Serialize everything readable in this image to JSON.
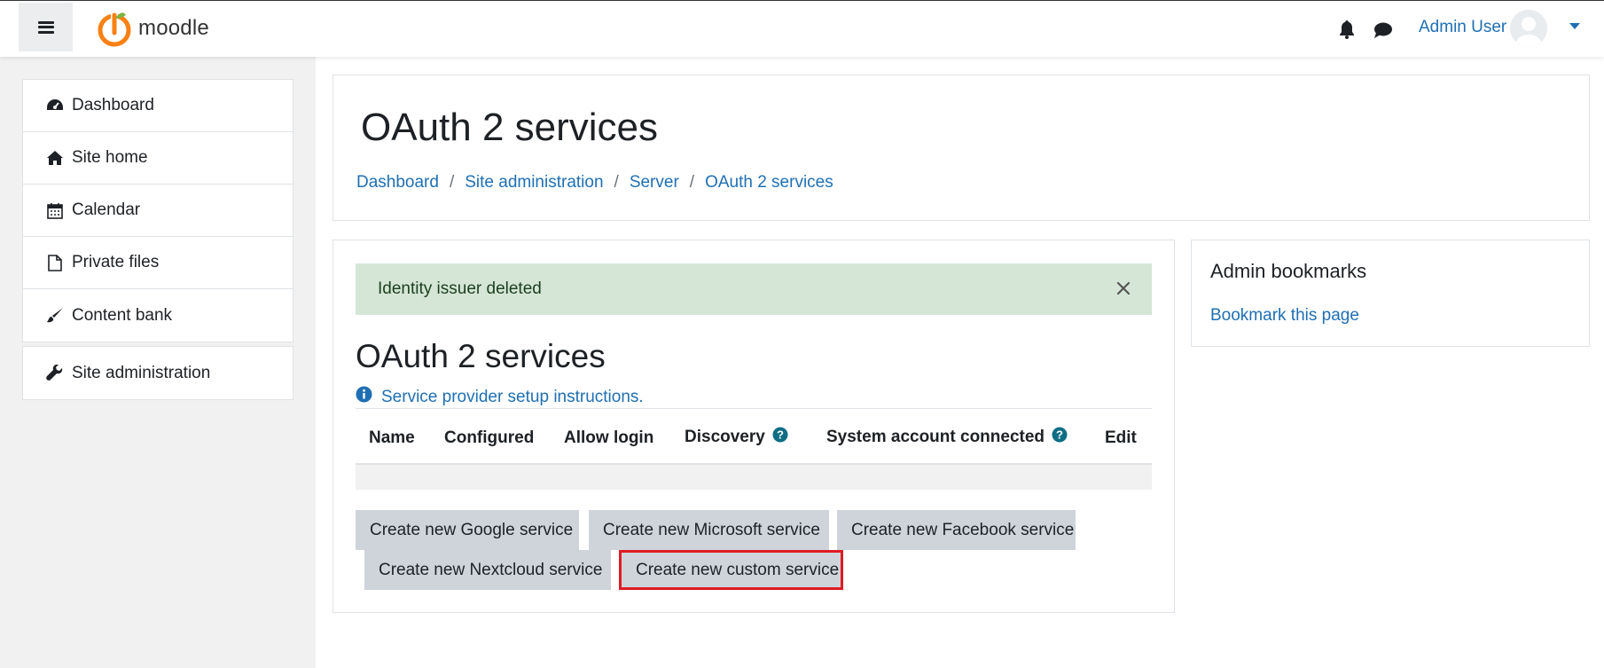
{
  "navbar": {
    "brand": "moodle",
    "user_name": "Admin User",
    "icons": {
      "menu": "hamburger-icon",
      "notifications": "bell-icon",
      "messages": "chat-icon",
      "dropdown": "caret-down-icon"
    }
  },
  "sidebar": {
    "items": [
      {
        "label": "Dashboard",
        "icon": "tachometer-icon"
      },
      {
        "label": "Site home",
        "icon": "home-icon"
      },
      {
        "label": "Calendar",
        "icon": "calendar-icon"
      },
      {
        "label": "Private files",
        "icon": "file-icon"
      },
      {
        "label": "Content bank",
        "icon": "paint-brush-icon"
      }
    ],
    "admin": {
      "label": "Site administration",
      "icon": "wrench-icon"
    }
  },
  "header": {
    "title": "OAuth 2 services",
    "breadcrumb": [
      "Dashboard",
      "Site administration",
      "Server",
      "OAuth 2 services"
    ]
  },
  "main": {
    "alert": "Identity issuer deleted",
    "section_title": "OAuth 2 services",
    "setup_link": "Service provider setup instructions.",
    "table": {
      "columns": [
        "Name",
        "Configured",
        "Allow login",
        "Discovery",
        "System account connected",
        "Edit"
      ]
    },
    "buttons": [
      "Create new Google service",
      "Create new Microsoft service",
      "Create new Facebook service",
      "Create new Nextcloud service",
      "Create new custom service"
    ]
  },
  "block": {
    "title": "Admin bookmarks",
    "link": "Bookmark this page"
  },
  "colors": {
    "link": "#1f6fb4",
    "alert_bg": "#d5e6d6",
    "button_bg": "#ced4da",
    "highlight": "#e01b24",
    "logo_orange": "#f98012"
  }
}
